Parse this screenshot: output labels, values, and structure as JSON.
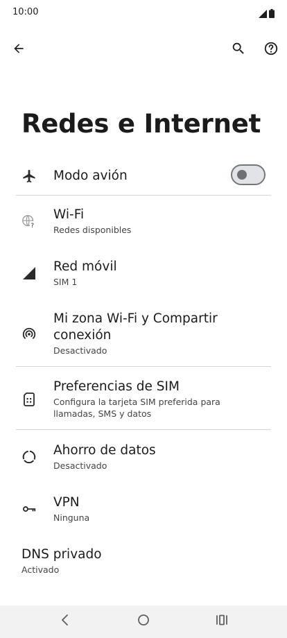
{
  "status_bar": {
    "time": "10:00",
    "signal_icon": "signal-icon",
    "battery_icon": "battery-icon"
  },
  "top_bar": {
    "back_icon": "back-arrow-icon",
    "search_icon": "search-icon",
    "help_icon": "help-icon"
  },
  "page": {
    "title": "Redes e Internet"
  },
  "items": {
    "airplane": {
      "title": "Modo avión",
      "icon": "airplane-icon",
      "toggle_on": false
    },
    "wifi": {
      "title": "Wi-Fi",
      "subtitle": "Redes disponibles",
      "icon": "wifi-question-icon"
    },
    "mobile": {
      "title": "Red móvil",
      "subtitle": "SIM 1",
      "icon": "cell-signal-icon"
    },
    "hotspot": {
      "title": "Mi zona Wi-Fi y Compartir conexión",
      "subtitle": "Desactivado",
      "icon": "hotspot-icon"
    },
    "sim": {
      "title": "Preferencias de SIM",
      "subtitle": "Configura la tarjeta SIM preferida para llamadas, SMS y datos",
      "icon": "sim-card-icon"
    },
    "data_saver": {
      "title": "Ahorro de datos",
      "subtitle": "Desactivado",
      "icon": "data-saver-icon"
    },
    "vpn": {
      "title": "VPN",
      "subtitle": "Ninguna",
      "icon": "vpn-key-icon"
    },
    "dns": {
      "title": "DNS privado",
      "subtitle": "Activado"
    }
  },
  "nav_bar": {
    "back_icon": "nav-back-icon",
    "home_icon": "nav-home-icon",
    "recents_icon": "nav-recents-icon"
  },
  "colors": {
    "background": "#ffffff",
    "text": "#1b1b1b",
    "subtext": "#444444",
    "divider": "#d4d4d4",
    "nav_bar": "#f2f2f2"
  }
}
